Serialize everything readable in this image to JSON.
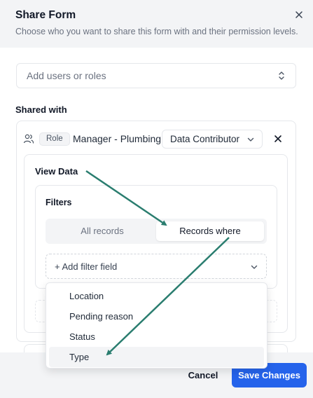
{
  "dialog": {
    "title": "Share Form",
    "subtitle": "Choose who you want to share this form with and their permission levels."
  },
  "combo": {
    "placeholder": "Add users or roles"
  },
  "shared_with": {
    "label": "Shared with",
    "entry": {
      "badge": "Role",
      "name": "Manager - Plumbing",
      "permission": "Data Contributor"
    }
  },
  "view_data": {
    "title": "View Data",
    "filters_title": "Filters",
    "segments": [
      "All records",
      "Records where"
    ],
    "selected_segment": "Records where",
    "add_filter_label": "+ Add filter field"
  },
  "dropdown": {
    "options": [
      "Location",
      "Pending reason",
      "Status",
      "Type"
    ],
    "highlighted": "Type"
  },
  "footer": {
    "cancel_label": "Cancel",
    "save_label": "Save Changes"
  },
  "colors": {
    "accent": "#2563eb",
    "annotation_arrow": "#2a7d6f",
    "header_bg": "#f3f4f6"
  }
}
